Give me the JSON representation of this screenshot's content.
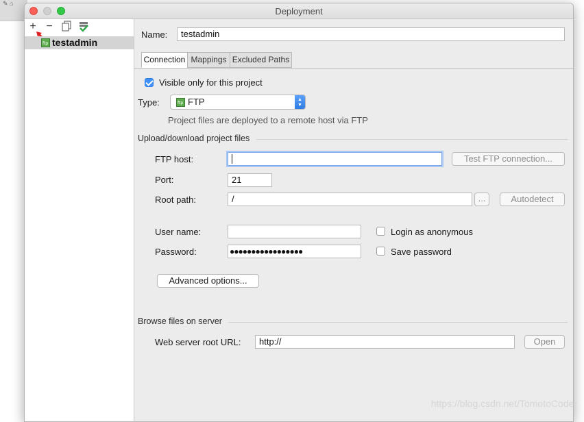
{
  "window": {
    "title": "Deployment"
  },
  "toolbar": {
    "add": "+",
    "remove": "−"
  },
  "tree": {
    "items": [
      {
        "label": "testadmin"
      }
    ]
  },
  "name": {
    "label": "Name:",
    "value": "testadmin"
  },
  "tabs": [
    {
      "label": "Connection"
    },
    {
      "label": "Mappings"
    },
    {
      "label": "Excluded Paths"
    }
  ],
  "visible_only": {
    "label": "Visible only for this project",
    "checked": true
  },
  "type": {
    "label": "Type:",
    "value": "FTP",
    "hint": "Project files are deployed to a remote host via FTP"
  },
  "upload": {
    "section": "Upload/download project files",
    "ftp_host_label": "FTP host:",
    "ftp_host_value": "",
    "test_button": "Test FTP connection...",
    "port_label": "Port:",
    "port_value": "21",
    "root_label": "Root path:",
    "root_value": "/",
    "browse_button": "...",
    "autodetect_button": "Autodetect",
    "user_label": "User name:",
    "user_value": "",
    "anonymous_label": "Login as anonymous",
    "password_label": "Password:",
    "password_value": "●●●●●●●●●●●●●●●●●",
    "save_password_label": "Save password",
    "advanced_button": "Advanced options..."
  },
  "browse": {
    "section": "Browse files on server",
    "url_label": "Web server root URL:",
    "url_value": "http://",
    "open_button": "Open"
  },
  "watermark": "https://blog.csdn.net/TomotoCoder",
  "colors": {
    "accent": "#3f8ff7",
    "close": "#fc5f57",
    "maximize": "#34c84a"
  }
}
